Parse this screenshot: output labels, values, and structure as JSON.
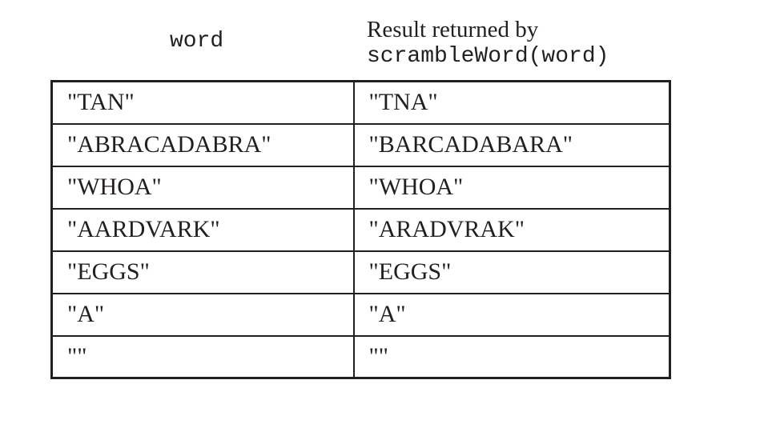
{
  "headers": {
    "word": "word",
    "result_line1": "Result returned by",
    "result_line2": "scrambleWord(word)"
  },
  "rows": [
    [
      "\"TAN\"",
      "\"TNA\""
    ],
    [
      "\"ABRACADABRA\"",
      "\"BARCADABARA\""
    ],
    [
      "\"WHOA\"",
      "\"WHOA\""
    ],
    [
      "\"AARDVARK\"",
      "\"ARADVRAK\""
    ],
    [
      "\"EGGS\"",
      "\"EGGS\""
    ],
    [
      "\"A\"",
      "\"A\""
    ],
    [
      "\"\"",
      "\"\""
    ]
  ]
}
